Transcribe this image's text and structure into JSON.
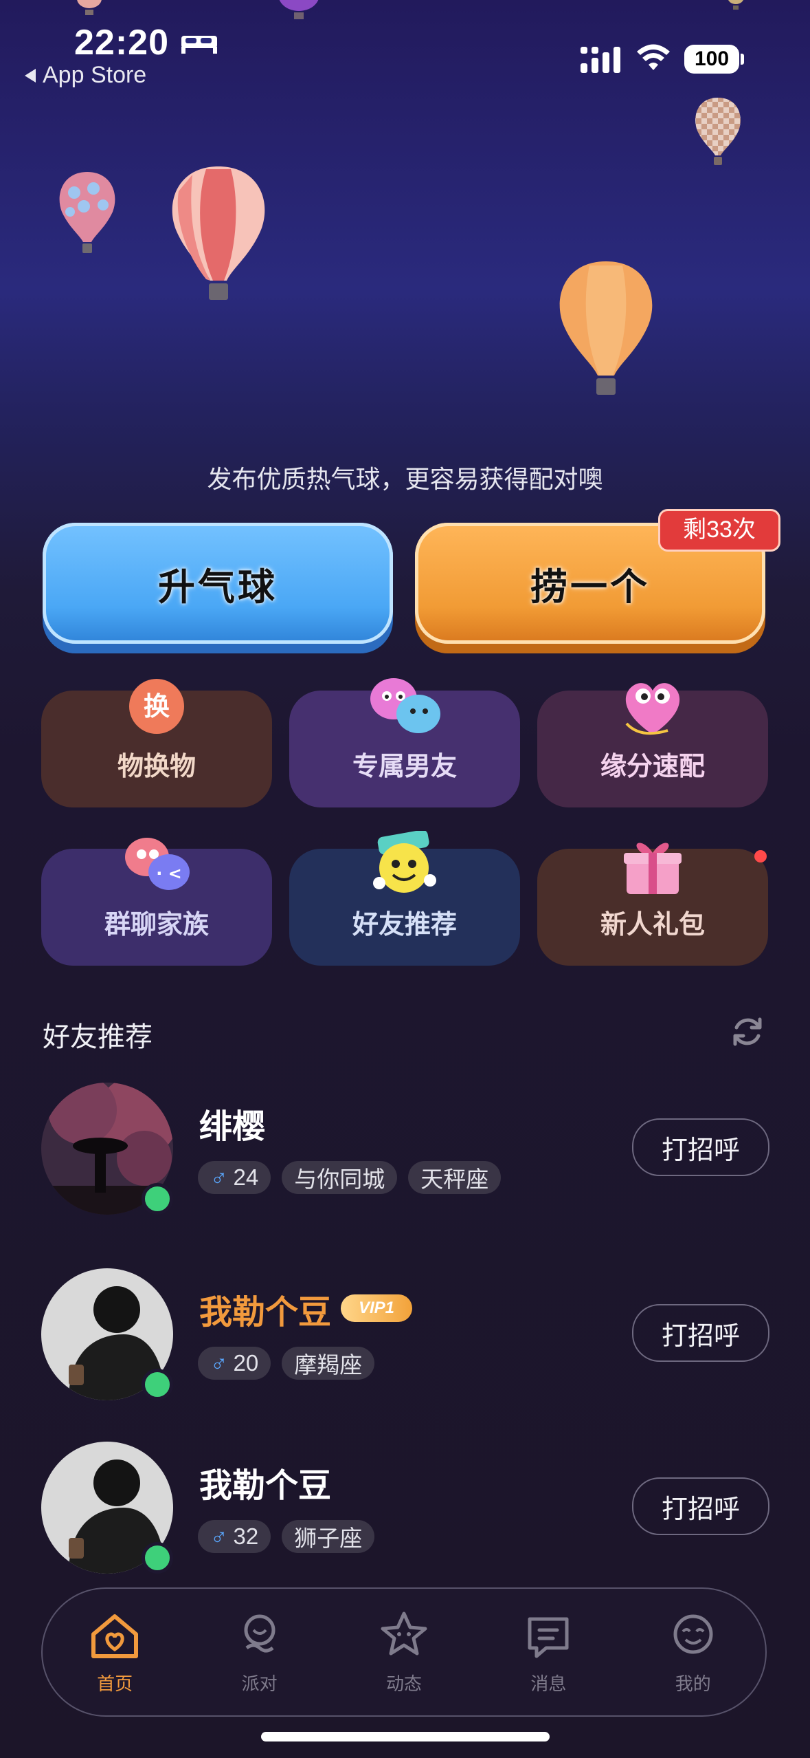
{
  "status_bar": {
    "time": "22:20",
    "back_app": "App Store",
    "battery": "100"
  },
  "hero": {
    "tagline": "发布优质热气球，更容易获得配对噢"
  },
  "actions": {
    "rise_label": "升气球",
    "catch_label": "捞一个",
    "catch_remaining": "剩33次"
  },
  "tiles": [
    {
      "label": "物换物",
      "icon": "swap-icon",
      "icon_text": "换",
      "color": "#4a2d2c"
    },
    {
      "label": "专属男友",
      "icon": "boyfriend-icon",
      "color": "#46306f"
    },
    {
      "label": "缘分速配",
      "icon": "heart-match-icon",
      "color": "#452847"
    },
    {
      "label": "群聊家族",
      "icon": "group-chat-icon",
      "color": "#3d2e6b"
    },
    {
      "label": "好友推荐",
      "icon": "friend-recommend-icon",
      "color": "#23305a"
    },
    {
      "label": "新人礼包",
      "icon": "gift-icon",
      "color": "#4a2e2a"
    }
  ],
  "friends": {
    "title": "好友推荐",
    "greet_label": "打招呼",
    "users": [
      {
        "name": "绯樱",
        "vip": false,
        "age": "24",
        "tags": [
          "与你同城",
          "天秤座"
        ]
      },
      {
        "name": "我勒个豆",
        "vip": true,
        "vip_label": "VIP1",
        "age": "20",
        "tags": [
          "摩羯座"
        ]
      },
      {
        "name": "我勒个豆",
        "vip": false,
        "age": "32",
        "tags": [
          "狮子座"
        ]
      }
    ]
  },
  "tabbar": {
    "items": [
      {
        "label": "首页",
        "icon": "home-icon",
        "active": true
      },
      {
        "label": "派对",
        "icon": "party-icon",
        "active": false
      },
      {
        "label": "动态",
        "icon": "moments-icon",
        "active": false
      },
      {
        "label": "消息",
        "icon": "message-icon",
        "active": false
      },
      {
        "label": "我的",
        "icon": "profile-icon",
        "active": false
      }
    ]
  },
  "colors": {
    "accent_orange": "#f29a3d",
    "accent_blue": "#4aa7f5",
    "online": "#3ed07a",
    "badge_red": "#e23b3b"
  }
}
